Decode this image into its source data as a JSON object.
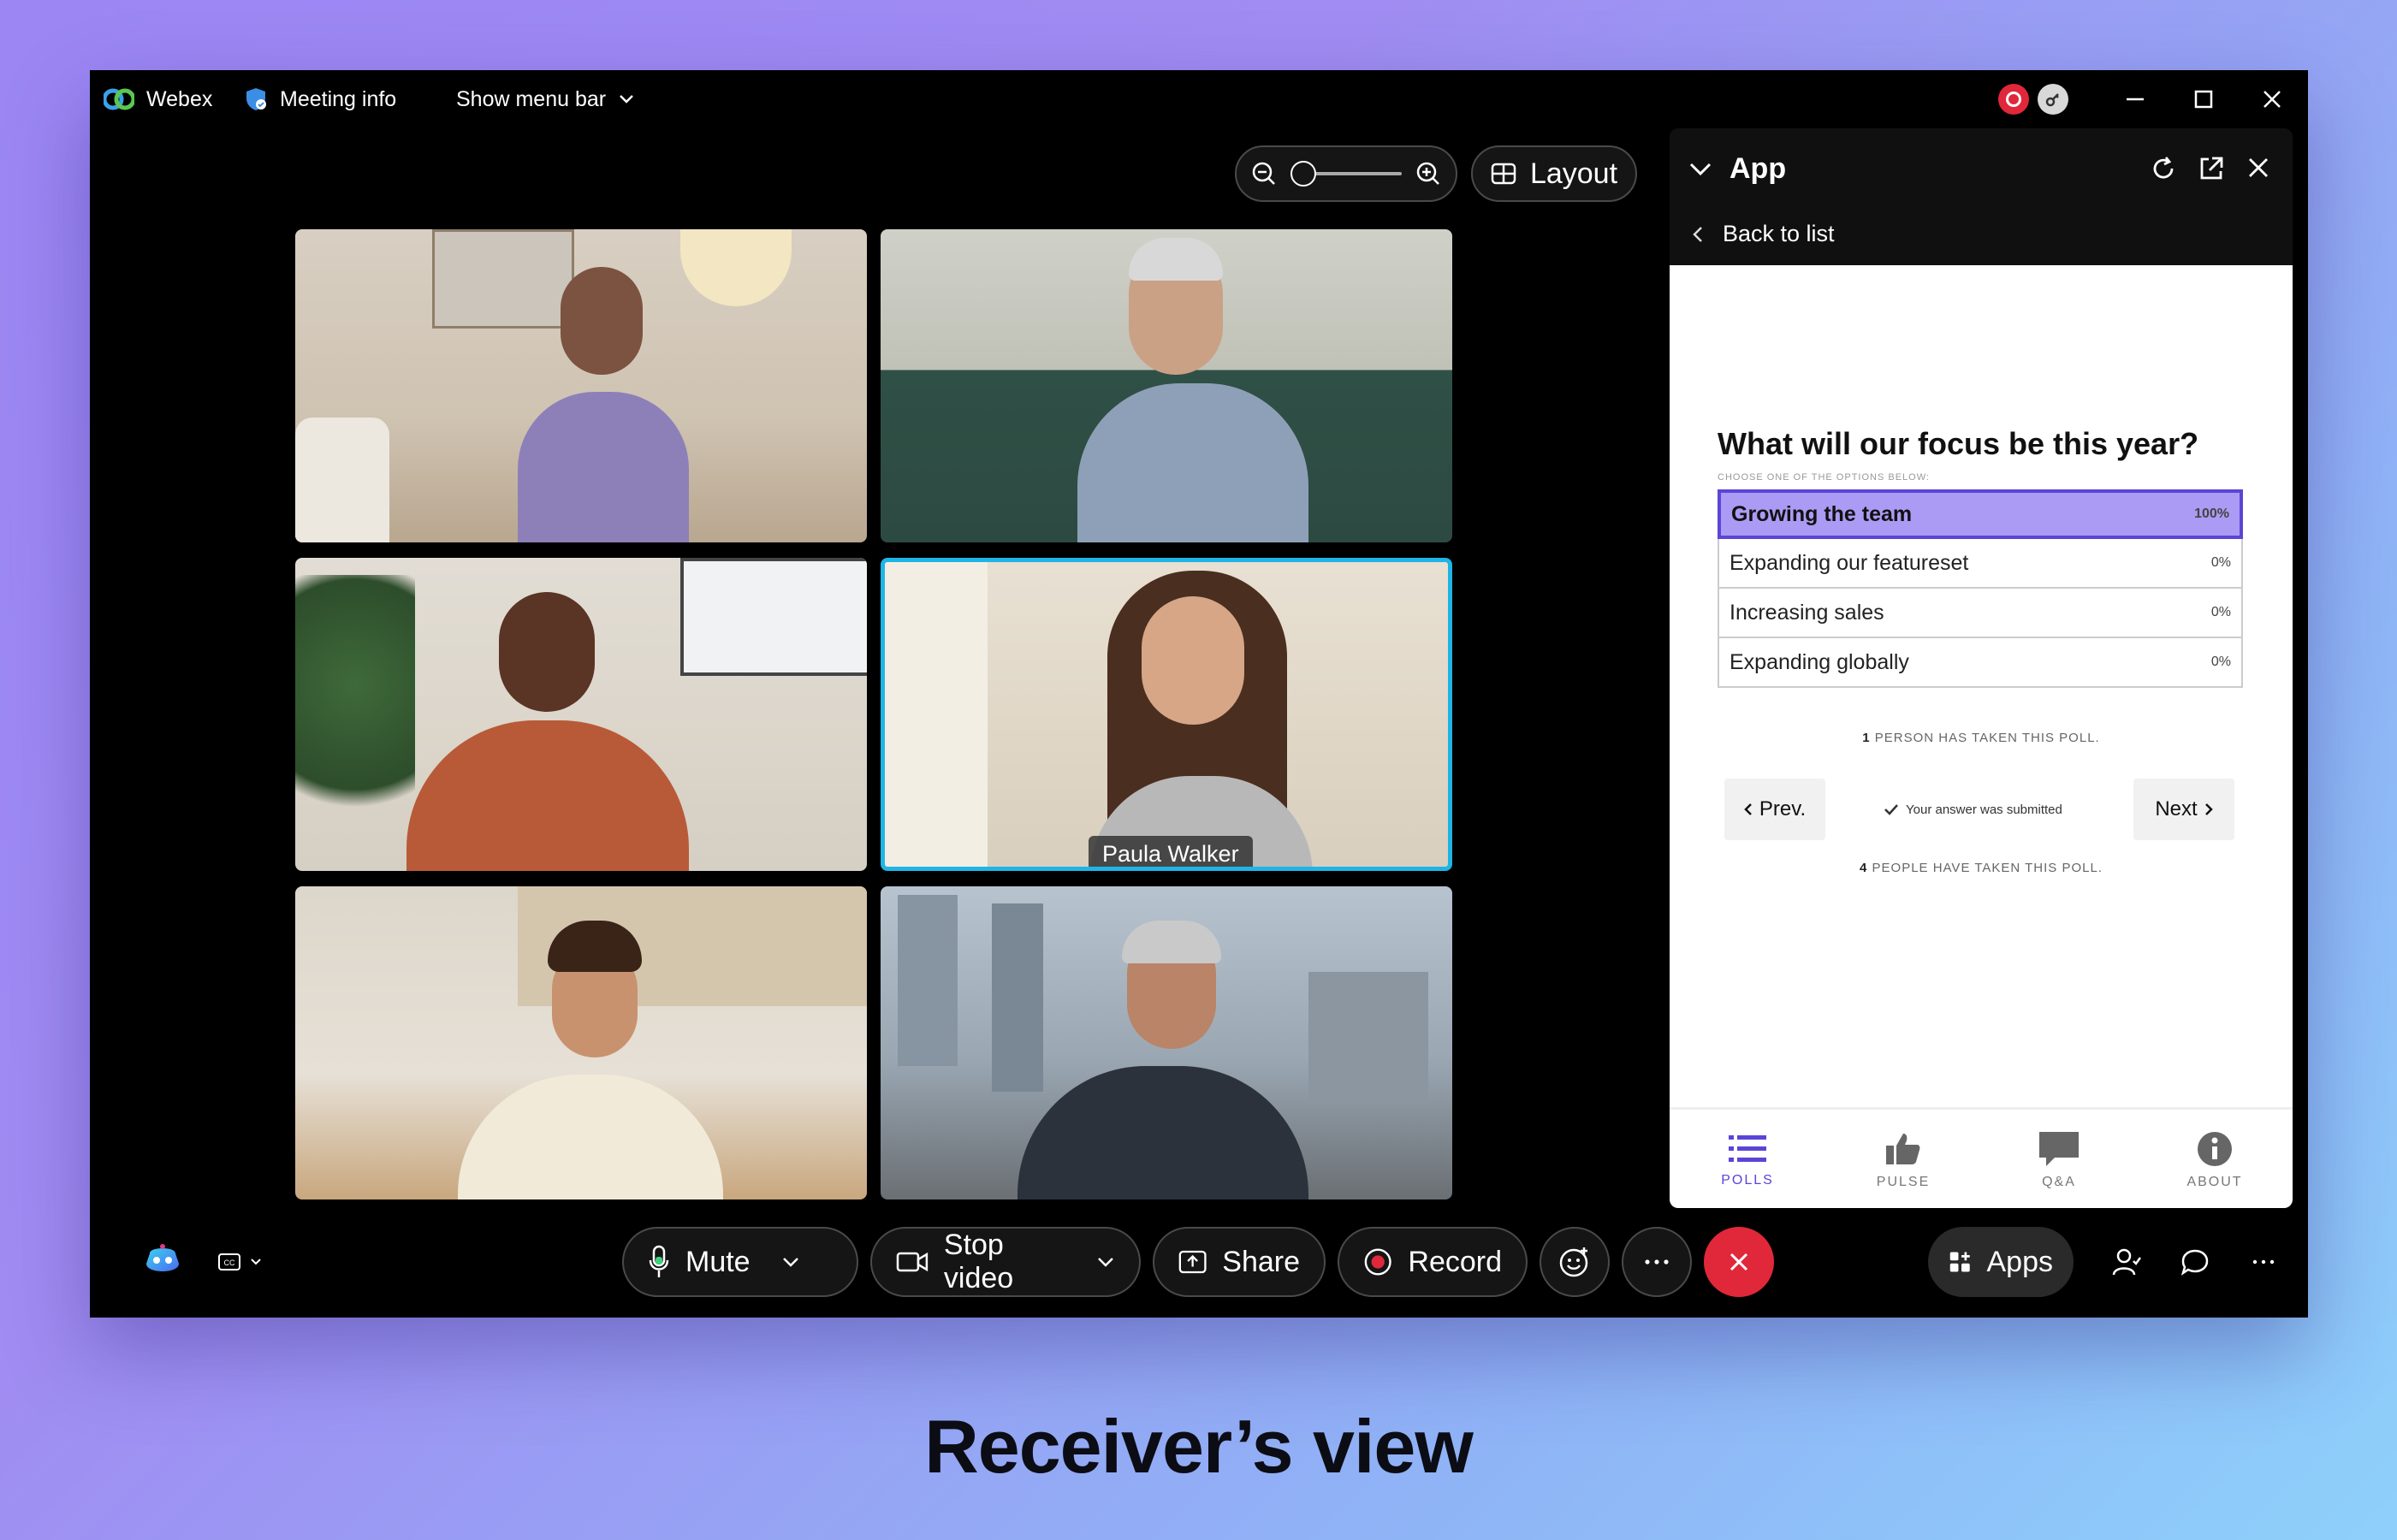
{
  "titlebar": {
    "app_name": "Webex",
    "meeting_info": "Meeting info",
    "show_menu_bar": "Show menu bar"
  },
  "toolbar": {
    "layout_label": "Layout",
    "zoom_level": 0.0
  },
  "participants": [
    {
      "name": ""
    },
    {
      "name": ""
    },
    {
      "name": ""
    },
    {
      "name": "Paula Walker",
      "active_speaker": true
    },
    {
      "name": ""
    },
    {
      "name": ""
    }
  ],
  "panel": {
    "title": "App",
    "back_label": "Back to list",
    "poll": {
      "question": "What will our focus be this year?",
      "subtitle": "CHOOSE ONE OF THE OPTIONS BELOW:",
      "options": [
        {
          "label": "Growing the team",
          "percent": "100%",
          "selected": true
        },
        {
          "label": "Expanding our featureset",
          "percent": "0%"
        },
        {
          "label": "Increasing sales",
          "percent": "0%"
        },
        {
          "label": "Expanding globally",
          "percent": "0%"
        }
      ],
      "taken_count": "1",
      "taken_text": "PERSON HAS TAKEN THIS POLL.",
      "prev_label": "Prev.",
      "next_label": "Next",
      "submitted_text": "Your answer was submitted",
      "people_count": "4",
      "people_text": "PEOPLE HAVE TAKEN THIS POLL."
    },
    "tabs": [
      {
        "label": "POLLS",
        "icon": "list-icon",
        "active": true
      },
      {
        "label": "PULSE",
        "icon": "thumbs-up-icon"
      },
      {
        "label": "Q&A",
        "icon": "speech-bubble-icon"
      },
      {
        "label": "ABOUT",
        "icon": "info-icon"
      }
    ]
  },
  "controls": {
    "mute_label": "Mute",
    "stop_video_label": "Stop video",
    "share_label": "Share",
    "record_label": "Record",
    "apps_label": "Apps"
  },
  "caption": "Receiver’s view",
  "colors": {
    "accent": "#5b45d6",
    "selected_option": "#ab9bf4",
    "end_call": "#e0283a",
    "active_speaker_border": "#1fb4e6"
  }
}
